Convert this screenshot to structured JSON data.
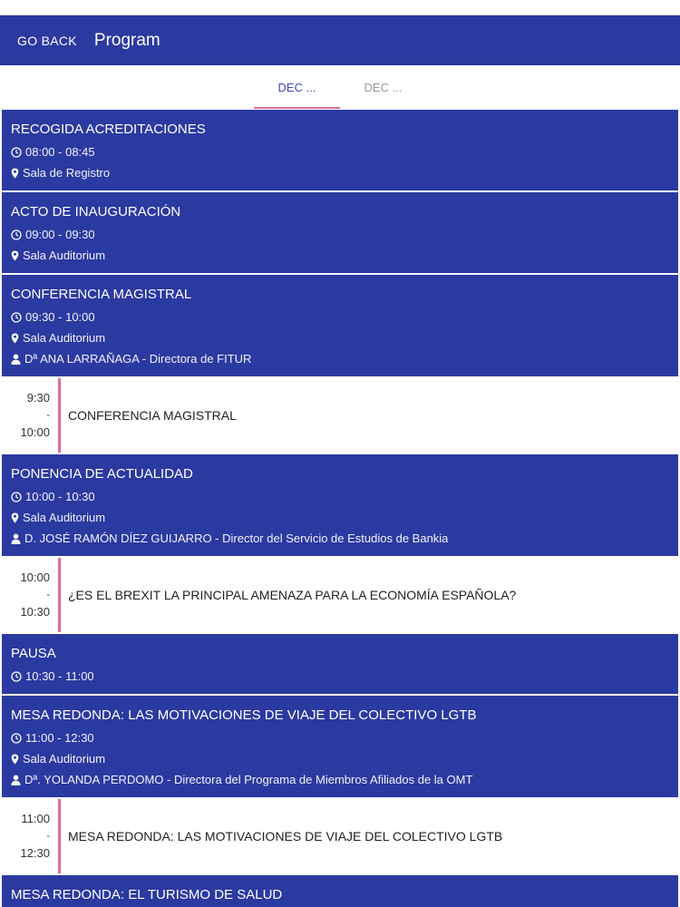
{
  "header": {
    "back_label": "GO BACK",
    "title": "Program"
  },
  "tabs": [
    {
      "label": "DEC ...",
      "active": true
    },
    {
      "label": "DEC ...",
      "active": false
    }
  ],
  "sessions": [
    {
      "title": "RECOGIDA ACREDITACIONES",
      "time": "08:00 - 08:45",
      "location": "Sala de Registro"
    },
    {
      "title": "ACTO DE INAUGURACIÓN",
      "time": "09:00 - 09:30",
      "location": "Sala Auditorium"
    },
    {
      "title": "CONFERENCIA MAGISTRAL",
      "time": "09:30 - 10:00",
      "location": "Sala Auditorium",
      "speaker": "Dª ANA LARRAÑAGA - Directora de FITUR"
    },
    {
      "title": "PONENCIA DE ACTUALIDAD",
      "time": "10:00 - 10:30",
      "location": "Sala Auditorium",
      "speaker": "D. JOSÉ RAMÓN DÍEZ GUIJARRO - Director del Servicio de Estudios de Bankia"
    },
    {
      "title": "PAUSA",
      "time": "10:30 - 11:00"
    },
    {
      "title": "MESA REDONDA: LAS MOTIVACIONES DE VIAJE DEL COLECTIVO LGTB",
      "time": "11:00 - 12:30",
      "location": "Sala Auditorium",
      "speaker": "Dª. YOLANDA PERDOMO - Directora del Programa de Miembros Afiliados de la OMT"
    },
    {
      "title": "MESA REDONDA: EL TURISMO DE SALUD"
    }
  ],
  "timeline": [
    {
      "start": "9:30",
      "sep": "-",
      "end": "10:00",
      "title": "CONFERENCIA MAGISTRAL"
    },
    {
      "start": "10:00",
      "sep": "-",
      "end": "10:30",
      "title": "¿ES EL BREXIT LA PRINCIPAL AMENAZA PARA LA ECONOMÍA ESPAÑOLA?"
    },
    {
      "start": "11:00",
      "sep": "-",
      "end": "12:30",
      "title": "MESA REDONDA: LAS MOTIVACIONES DE VIAJE DEL COLECTIVO LGTB"
    }
  ],
  "colors": {
    "appbar": "#2b3aa0",
    "card": "#2b3aa0",
    "accent_pink": "#e06a9a",
    "tab_active": "#3e4bb0"
  },
  "icons": {
    "time": "clock-icon",
    "location": "map-pin-icon",
    "speaker": "person-icon"
  }
}
